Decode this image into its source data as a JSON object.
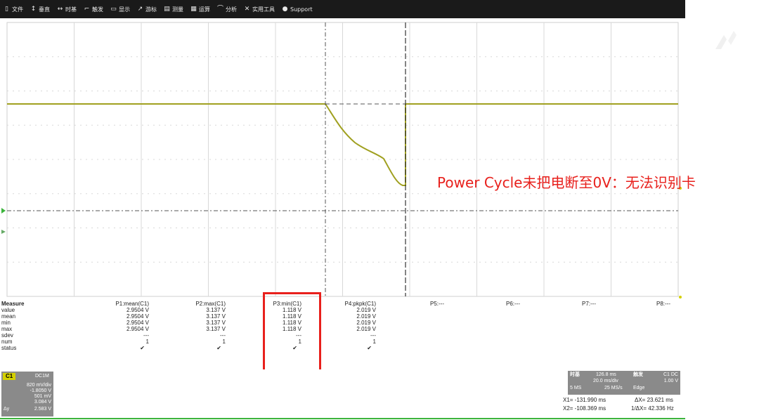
{
  "menubar": {
    "items": [
      {
        "icon": "file-icon",
        "glyph": "▯",
        "label": "文件"
      },
      {
        "icon": "vertical-icon",
        "glyph": "↕",
        "label": "垂直"
      },
      {
        "icon": "timebase-icon",
        "glyph": "↔",
        "label": "时基"
      },
      {
        "icon": "trigger-icon",
        "glyph": "⌐",
        "label": "触发"
      },
      {
        "icon": "display-icon",
        "glyph": "▭",
        "label": "显示"
      },
      {
        "icon": "cursor-icon",
        "glyph": "↗",
        "label": "游标"
      },
      {
        "icon": "measure-icon",
        "glyph": "▤",
        "label": "测量"
      },
      {
        "icon": "math-icon",
        "glyph": "▦",
        "label": "运算"
      },
      {
        "icon": "analysis-icon",
        "glyph": "⌒",
        "label": "分析"
      },
      {
        "icon": "tools-icon",
        "glyph": "✕",
        "label": "实用工具"
      },
      {
        "icon": "support-icon",
        "glyph": "●",
        "label": "Support"
      }
    ]
  },
  "annotation": "Power Cycle未把电断至0V：无法识别卡",
  "measure": {
    "row_labels": [
      "Measure",
      "value",
      "mean",
      "min",
      "max",
      "sdev",
      "num",
      "status"
    ],
    "params": [
      {
        "header": "P1:mean(C1)",
        "values": [
          "2.9504 V",
          "2.9504 V",
          "2.9504 V",
          "2.9504 V",
          "---",
          "1",
          "✔"
        ]
      },
      {
        "header": "P2:max(C1)",
        "values": [
          "3.137 V",
          "3.137 V",
          "3.137 V",
          "3.137 V",
          "---",
          "1",
          "✔"
        ]
      },
      {
        "header": "P3:min(C1)",
        "values": [
          "1.118 V",
          "1.118 V",
          "1.118 V",
          "1.118 V",
          "---",
          "1",
          "✔"
        ]
      },
      {
        "header": "P4:pkpk(C1)",
        "values": [
          "2.019 V",
          "2.019 V",
          "2.019 V",
          "2.019 V",
          "---",
          "1",
          "✔"
        ]
      }
    ],
    "empty_params": [
      "P5:---",
      "P6:---",
      "P7:---",
      "P8:---"
    ]
  },
  "channel": {
    "badge": "C1",
    "coupling": "DC1M",
    "scale": "820 mV/div",
    "offset": "-1.8050 V",
    "cursor1": "501 mV",
    "cursor2": "3.084 V",
    "delta_label": "Δy",
    "delta": "2.583 V"
  },
  "timebase": {
    "label": "时基",
    "delay": "126.8 ms",
    "scale": "20.0 ms/div",
    "samples": "5 MS",
    "rate": "25 MS/s",
    "trigger_label": "触发",
    "trigger_ch": "C1 DC",
    "trigger_level": "1.00 V",
    "trigger_type": "Edge"
  },
  "cursors": {
    "x1": "X1=   -131.990 ms",
    "dx": "ΔX=   23.621 ms",
    "x2": "X2=   -108.369 ms",
    "inv_dx": "1/ΔX=   42.336 Hz"
  },
  "colors": {
    "trace": "#a0a020",
    "highlight": "#e8201c",
    "menubar": "#1a1a1a"
  },
  "chart_data": {
    "type": "line",
    "xlabel": "",
    "ylabel": "",
    "grid": true
  }
}
